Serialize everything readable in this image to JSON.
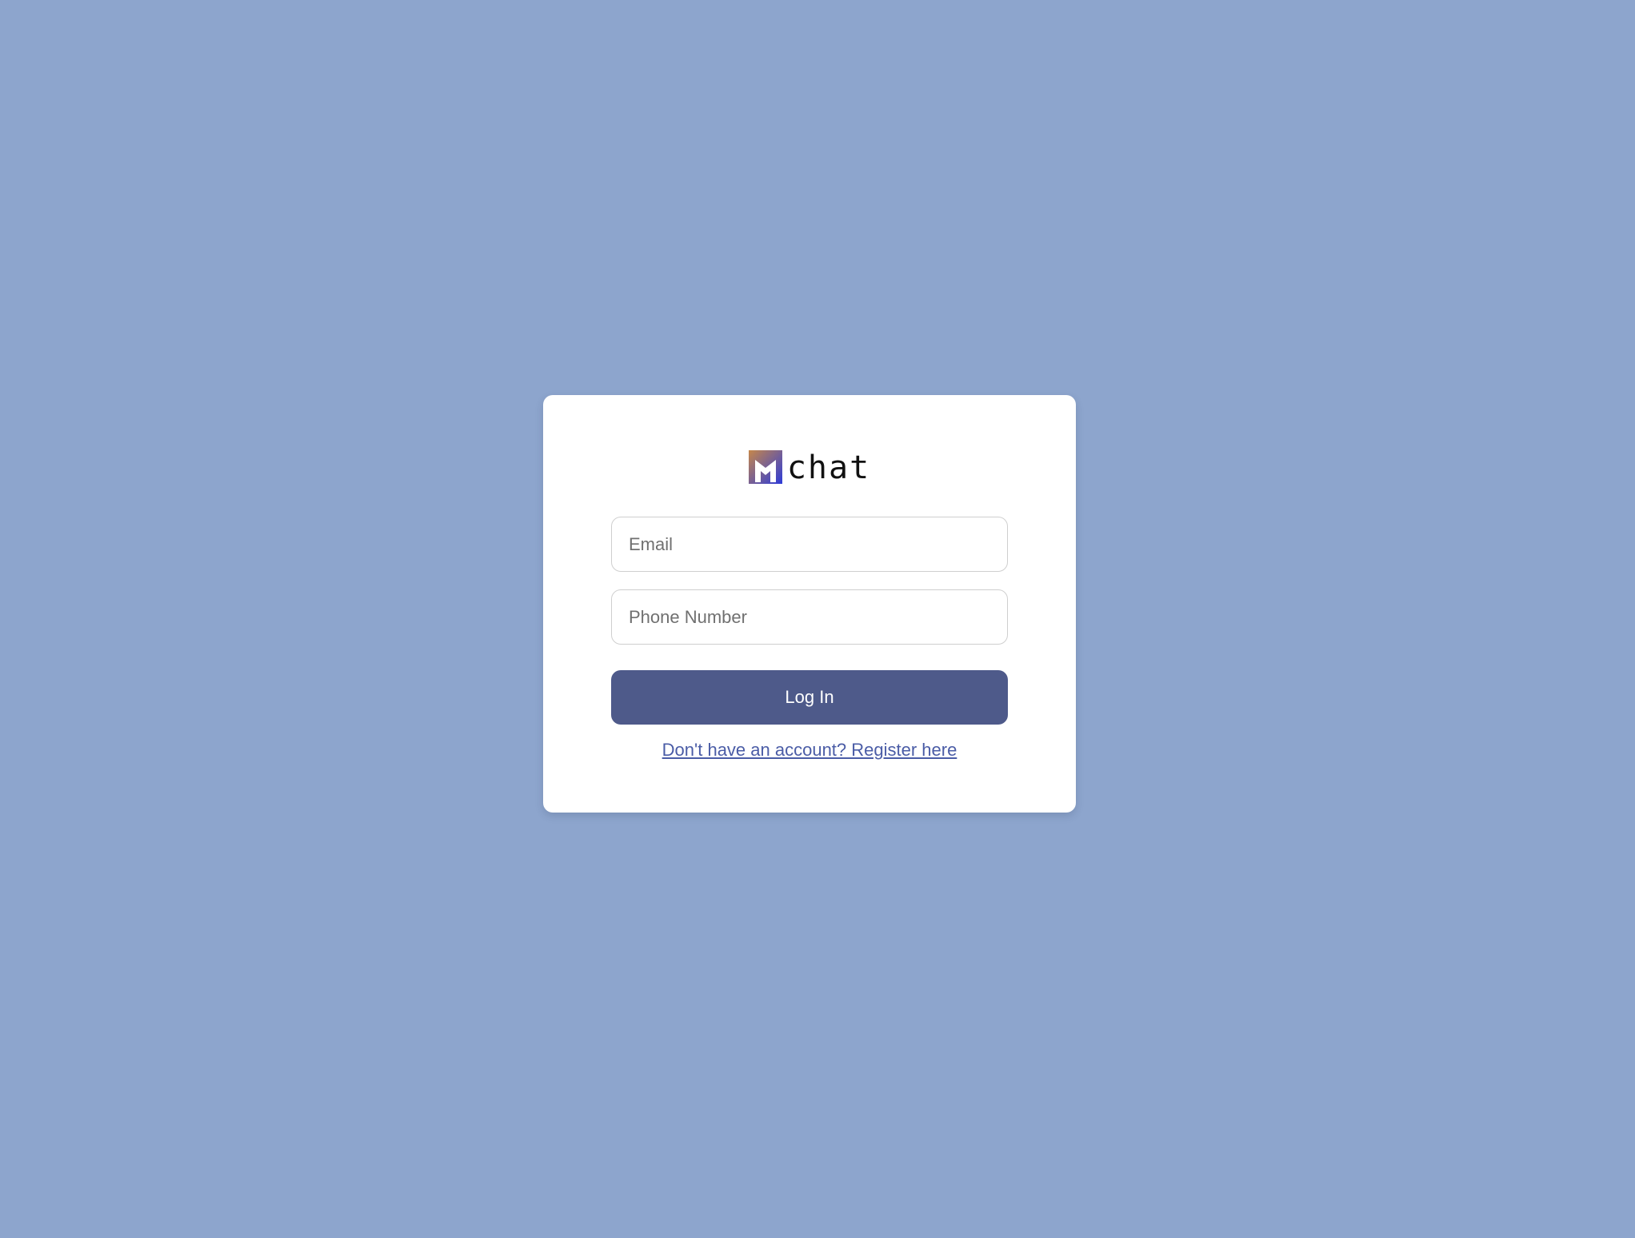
{
  "brand": {
    "name": "chat",
    "logo_icon": "m-logo-icon",
    "logo_colors": [
      "#c6874a",
      "#2d3bd9"
    ]
  },
  "form": {
    "email_placeholder": "Email",
    "phone_placeholder": "Phone Number",
    "submit_label": "Log In",
    "register_link": "Don't have an account? Register here"
  },
  "colors": {
    "background": "#8da5cd",
    "card": "#ffffff",
    "button": "#4e5a8a",
    "link": "#4a5ca6"
  }
}
